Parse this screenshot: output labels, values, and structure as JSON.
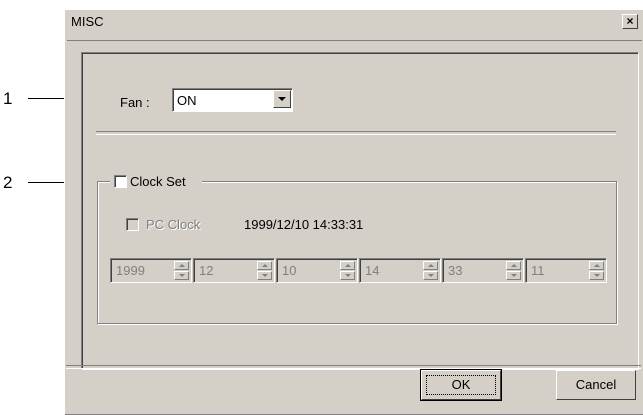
{
  "callouts": [
    "1",
    "2"
  ],
  "window": {
    "title": "MISC",
    "close_label": "×"
  },
  "fan": {
    "label": "Fan :",
    "value": "ON"
  },
  "clock_set": {
    "label": "Clock Set",
    "checked": false
  },
  "pc_clock": {
    "label": "PC Clock",
    "datetime": "1999/12/10 14:33:31",
    "checked": false
  },
  "spinners": [
    {
      "name": "year",
      "value": "1999"
    },
    {
      "name": "month",
      "value": "12"
    },
    {
      "name": "day",
      "value": "10"
    },
    {
      "name": "hour",
      "value": "14"
    },
    {
      "name": "minute",
      "value": "33"
    },
    {
      "name": "second",
      "value": "11"
    }
  ],
  "buttons": {
    "ok": "OK",
    "cancel": "Cancel"
  }
}
